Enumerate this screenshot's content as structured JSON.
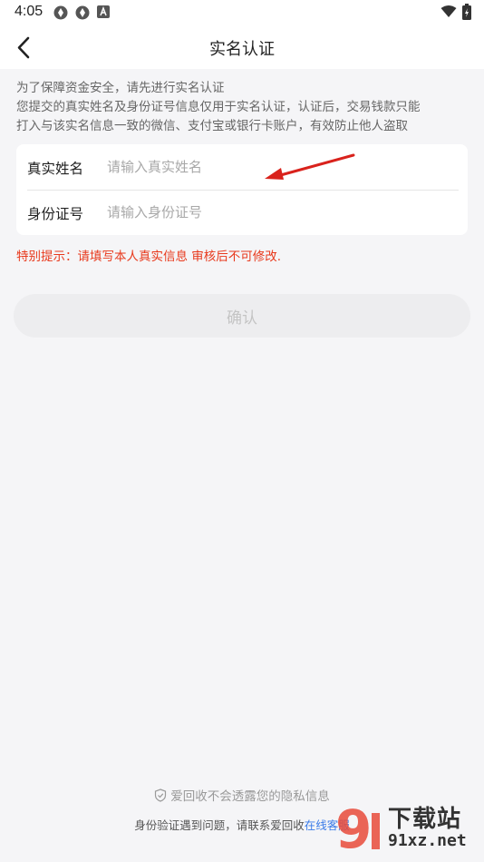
{
  "status_bar": {
    "time": "4:05"
  },
  "header": {
    "title": "实名认证"
  },
  "notice": {
    "line1": "为了保障资金安全，请先进行实名认证",
    "line2": "您提交的真实姓名及身份证号信息仅用于实名认证，认证后，交易钱款只能",
    "line3": "打入与该实名信息一致的微信、支付宝或银行卡账户，有效防止他人盗取"
  },
  "form": {
    "name_label": "真实姓名",
    "name_value": "",
    "name_placeholder": "请输入真实姓名",
    "id_label": "身份证号",
    "id_value": "",
    "id_placeholder": "请输入身份证号"
  },
  "warning": "特别提示：请填写本人真实信息 审核后不可修改.",
  "confirm_label": "确认",
  "footer": {
    "privacy": "爱回收不会透露您的隐私信息",
    "help_text": "身份验证遇到问题，请联系爱回收",
    "help_link": "在线客服"
  },
  "watermark": {
    "text": "下载站",
    "url": "91xz.net"
  },
  "colors": {
    "warning": "#e8391c",
    "link": "#3a7be8",
    "annotation_arrow": "#d9221c"
  },
  "icons": {
    "back": "chevron-left-icon",
    "privacy": "shield-check-icon"
  }
}
